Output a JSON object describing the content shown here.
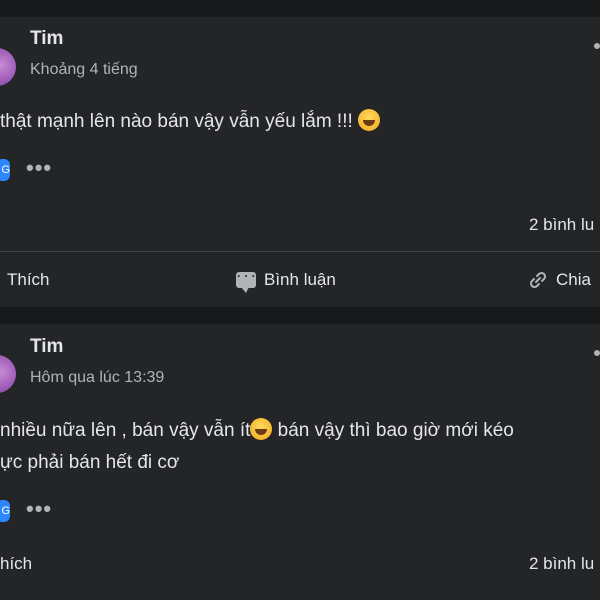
{
  "posts": [
    {
      "author": "Tim",
      "time": "Khoảng 4 tiếng",
      "text_line1_before_emoji": " thật mạnh lên nào bán vậy vẫn yếu lắm !!! ",
      "reaction_chip": "G",
      "comment_count": "2 bình lu",
      "actions": {
        "like": "Thích",
        "comment": "Bình luận",
        "share": "Chia"
      }
    },
    {
      "author": "Tim",
      "time": "Hôm qua lúc 13:39",
      "text_line1_before_emoji": " nhiều nữa lên , bán vậy vẫn ít",
      "text_line1_after_emoji": " bán vậy thì bao giờ mới kéo",
      "text_line2": "ực phải bán hết đi cơ",
      "reaction_chip": "G",
      "comment_count": "2 bình lu",
      "actions": {
        "like": "hích"
      }
    }
  ],
  "icons": {
    "emoji": "rolling-on-floor-laughing",
    "more": "more-horizontal",
    "comment": "speech-bubble",
    "share": "link"
  }
}
